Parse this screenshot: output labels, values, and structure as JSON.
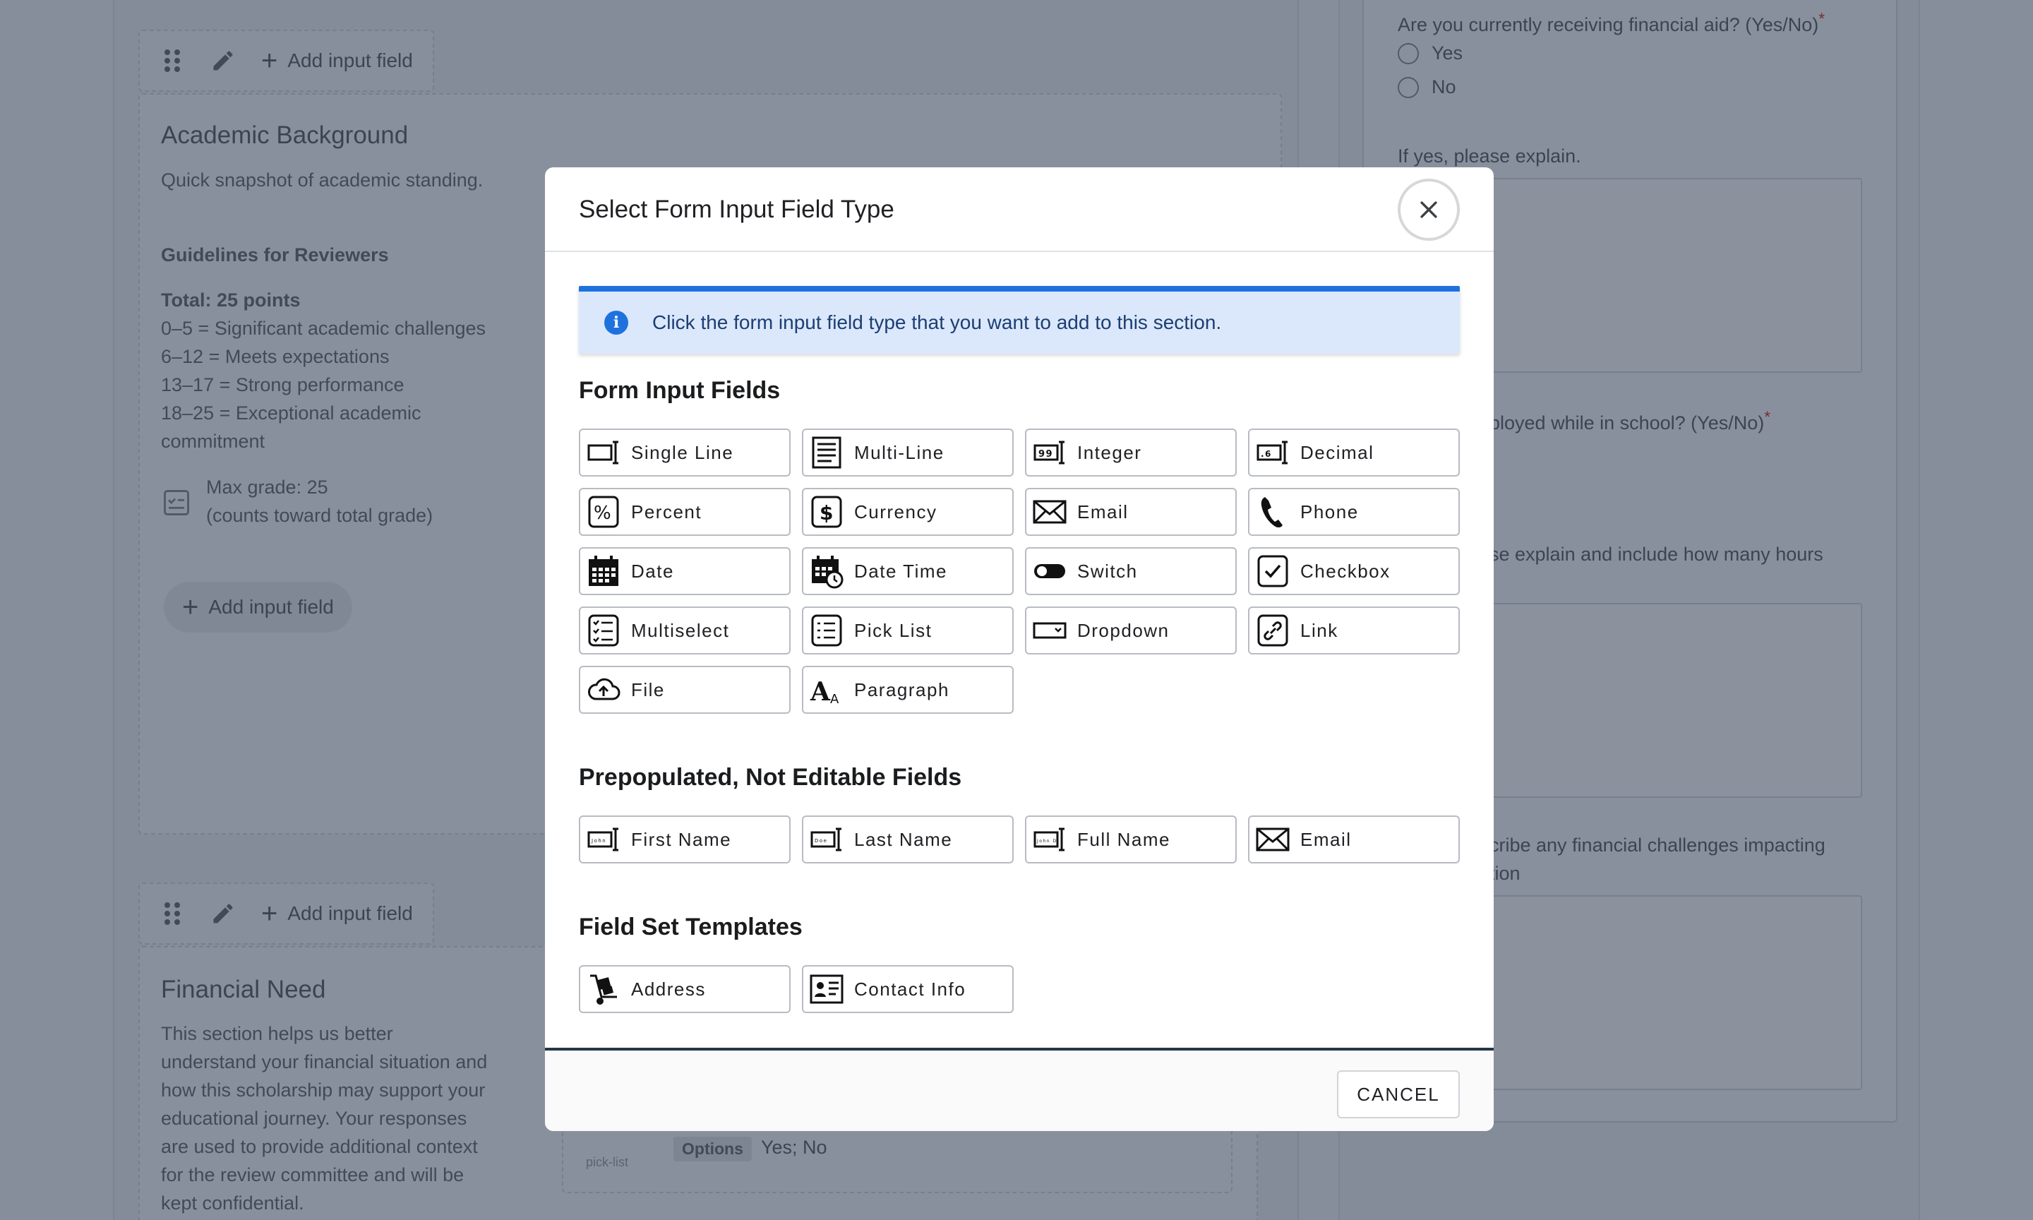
{
  "background": {
    "toolbar": {
      "add_label": "Add input field"
    },
    "academic": {
      "title": "Academic Background",
      "subtitle": "Quick snapshot of academic standing.",
      "guidelines_heading": "Guidelines for Reviewers",
      "total": "Total: 25 points",
      "lines": [
        "0–5 = Significant academic challenges",
        "6–12 = Meets expectations",
        "13–17 = Strong performance",
        "18–25 = Exceptional academic",
        "commitment"
      ],
      "max_grade": "Max grade: 25",
      "max_grade_note": "(counts toward total grade)",
      "add_label": "Add input field"
    },
    "financial": {
      "title": "Financial Need",
      "lines": [
        "This section helps us better",
        "understand your financial situation and",
        "how this scholarship may support your",
        "educational journey. Your responses",
        "are used to provide additional context",
        "for the review committee and will be",
        "kept confidential."
      ],
      "pick_list_caption": "pick-list",
      "options_label": "Options",
      "options_value": "Yes; No"
    },
    "preview": {
      "q1": "Are you currently receiving financial aid? (Yes/No)",
      "opt_yes": "Yes",
      "opt_no": "No",
      "q2": "If yes, please explain.",
      "q3": "ployed while in school? (Yes/No)",
      "q4": "se explain and include how many hours",
      "q5a": "cribe any financial challenges impacting",
      "q5b": "tion",
      "required_mark": "*"
    }
  },
  "modal": {
    "title": "Select Form Input Field Type",
    "info": "Click the form input field type that you want to add to this section.",
    "sections": {
      "form_inputs": {
        "heading": "Form Input Fields",
        "items": [
          "Single Line",
          "Multi-Line",
          "Integer",
          "Decimal",
          "Percent",
          "Currency",
          "Email",
          "Phone",
          "Date",
          "Date Time",
          "Switch",
          "Checkbox",
          "Multiselect",
          "Pick List",
          "Dropdown",
          "Link",
          "File",
          "Paragraph"
        ]
      },
      "prepopulated": {
        "heading": "Prepopulated, Not Editable Fields",
        "items": [
          "First Name",
          "Last Name",
          "Full Name",
          "Email"
        ]
      },
      "templates": {
        "heading": "Field Set Templates",
        "items": [
          "Address",
          "Contact Info"
        ]
      }
    },
    "cancel": "CANCEL"
  }
}
